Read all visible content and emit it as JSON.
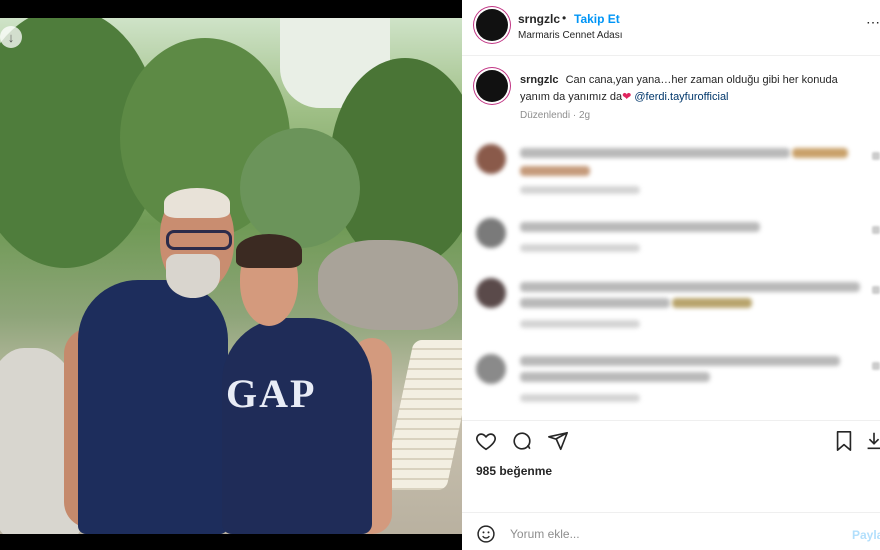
{
  "post": {
    "username": "srngzlc",
    "follow_label": "Takip Et",
    "location": "Marmaris Cennet Adası",
    "caption_username": "srngzlc",
    "caption_text": "Can cana,yan yana…her zaman olduğu gibi her konuda yanım da yanımız da",
    "caption_mention": "@ferdi.tayfurofficial",
    "edited_label": "Düzenlendi",
    "edited_age": "2g",
    "likes_text": "985 beğenme",
    "comment_placeholder": "Yorum ekle...",
    "post_label": "Paylaş"
  },
  "colors": {
    "follow_blue": "#0095f6",
    "heart_red": "#e0245e",
    "mention": "#00376b"
  },
  "icons": [
    "heart-icon",
    "comment-icon",
    "share-icon",
    "bookmark-icon",
    "download-icon",
    "emoji-icon",
    "more-icon"
  ]
}
